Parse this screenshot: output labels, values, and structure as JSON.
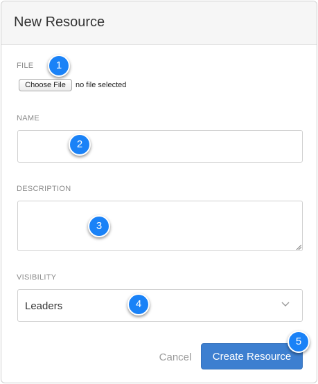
{
  "modal": {
    "title": "New Resource"
  },
  "form": {
    "file": {
      "label": "FILE",
      "button_label": "Choose File",
      "status": "no file selected"
    },
    "name": {
      "label": "NAME",
      "value": ""
    },
    "description": {
      "label": "DESCRIPTION",
      "value": ""
    },
    "visibility": {
      "label": "VISIBILITY",
      "selected": "Leaders"
    }
  },
  "footer": {
    "cancel_label": "Cancel",
    "create_label": "Create Resource"
  },
  "callouts": [
    "1",
    "2",
    "3",
    "4",
    "5"
  ],
  "colors": {
    "primary_button": "#3d7fd0",
    "callout_badge": "#1a82f7"
  }
}
